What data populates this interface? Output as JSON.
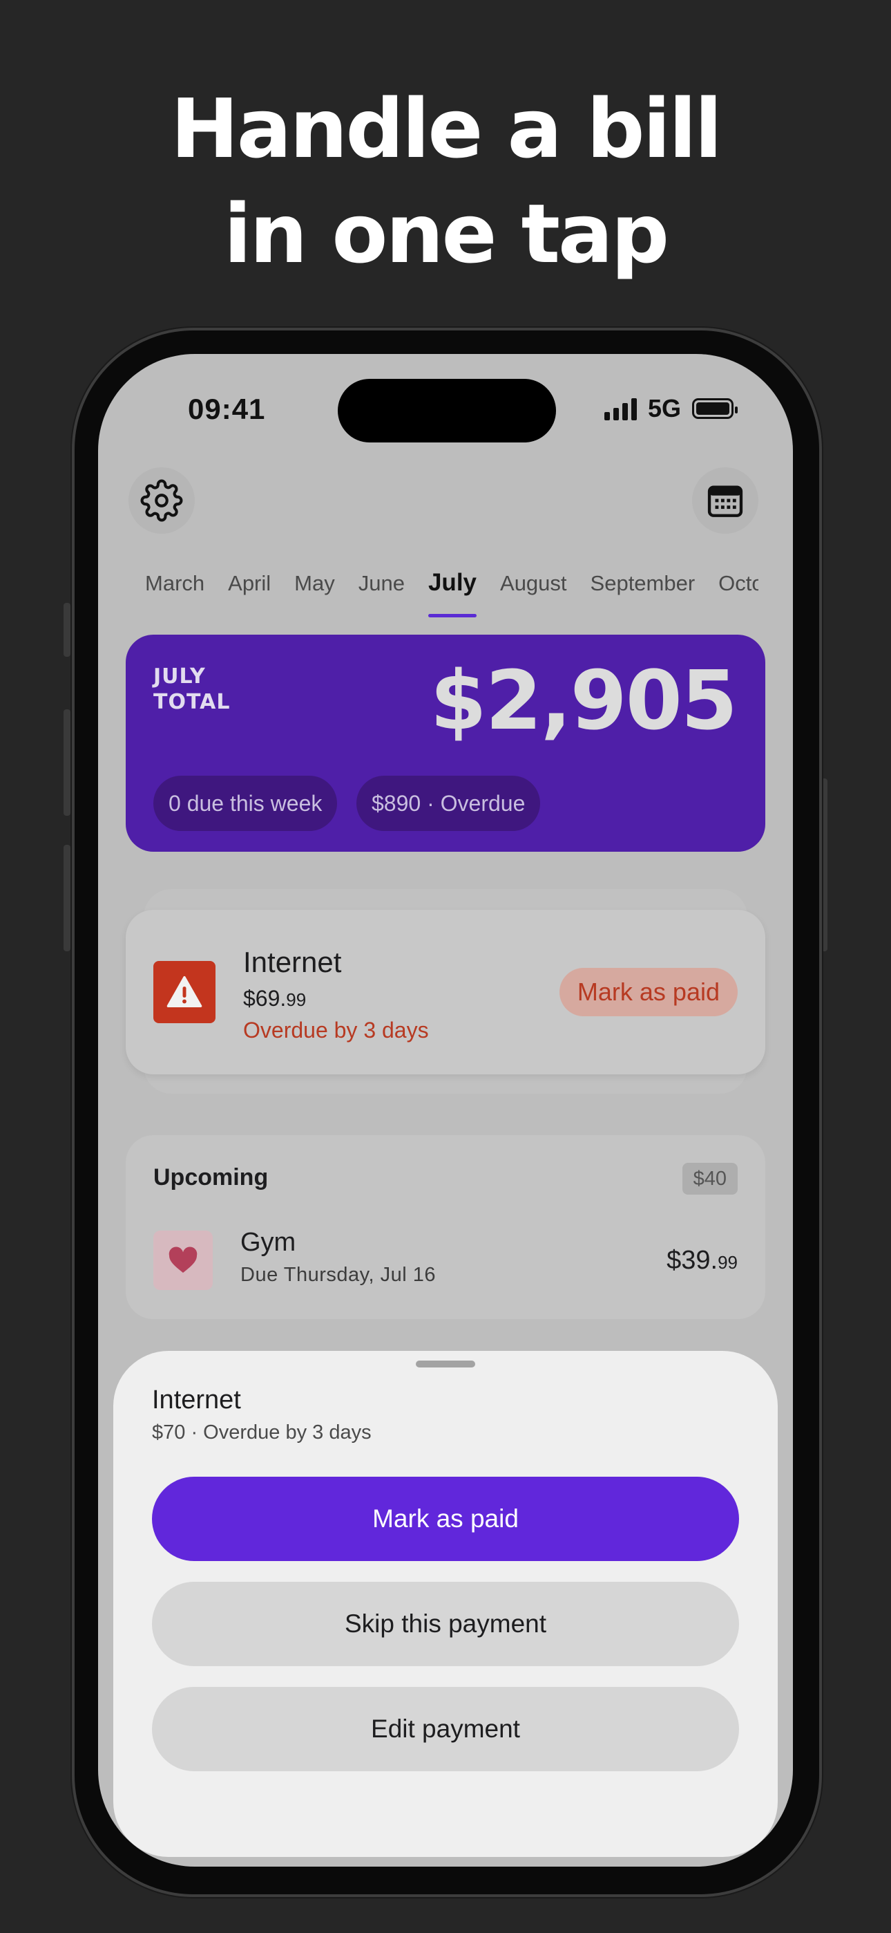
{
  "headline": {
    "line1": "Handle a bill",
    "line2": "in one tap"
  },
  "status_bar": {
    "time": "09:41",
    "network": "5G"
  },
  "header": {
    "settings_icon": "gear-icon",
    "calendar_icon": "calendar-icon"
  },
  "months": [
    {
      "label": "March",
      "active": false
    },
    {
      "label": "April",
      "active": false
    },
    {
      "label": "May",
      "active": false
    },
    {
      "label": "June",
      "active": false
    },
    {
      "label": "July",
      "active": true
    },
    {
      "label": "August",
      "active": false
    },
    {
      "label": "September",
      "active": false
    },
    {
      "label": "October",
      "active": false
    }
  ],
  "total_card": {
    "label_line1": "JULY",
    "label_line2": "TOTAL",
    "amount": "$2,905",
    "due_this_week": "0 due this week",
    "overdue": "$890 · Overdue",
    "color": "#4f1fa8"
  },
  "overdue_bill": {
    "name": "Internet",
    "amount_main": "$69.",
    "amount_cents": "99",
    "status": "Overdue by 3 days",
    "action_label": "Mark as paid",
    "icon": "warning-icon"
  },
  "upcoming": {
    "title": "Upcoming",
    "badge": "$40",
    "items": [
      {
        "name": "Gym",
        "due": "Due Thursday, Jul 16",
        "amount_main": "$39.",
        "amount_cents": "99",
        "icon": "heart-icon"
      }
    ]
  },
  "sheet": {
    "title": "Internet",
    "subtitle": "$70 · Overdue by 3 days",
    "primary_label": "Mark as paid",
    "skip_label": "Skip this payment",
    "edit_label": "Edit payment",
    "accent": "#6127db"
  }
}
